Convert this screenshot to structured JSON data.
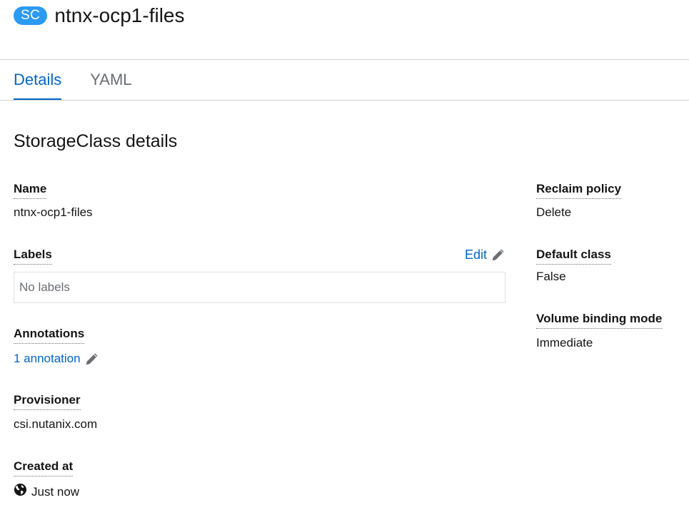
{
  "header": {
    "badge": "SC",
    "title": "ntnx-ocp1-files"
  },
  "tabs": [
    {
      "label": "Details",
      "active": true
    },
    {
      "label": "YAML",
      "active": false
    }
  ],
  "section": {
    "title": "StorageClass details"
  },
  "left": {
    "name": {
      "label": "Name",
      "value": "ntnx-ocp1-files"
    },
    "labels": {
      "label": "Labels",
      "edit_label": "Edit",
      "empty_text": "No labels"
    },
    "annotations": {
      "label": "Annotations",
      "link_text": "1 annotation"
    },
    "provisioner": {
      "label": "Provisioner",
      "value": "csi.nutanix.com"
    },
    "created_at": {
      "label": "Created at",
      "value": "Just now",
      "icon": "globe-icon"
    }
  },
  "right": {
    "reclaim_policy": {
      "label": "Reclaim policy",
      "value": "Delete"
    },
    "default_class": {
      "label": "Default class",
      "value": "False"
    },
    "volume_binding_mode": {
      "label": "Volume binding mode",
      "value": "Immediate"
    }
  },
  "colors": {
    "accent": "#0066cc",
    "badge": "#2b9af3",
    "text": "#151515",
    "muted": "#6a6e73",
    "border": "#d2d2d2"
  }
}
